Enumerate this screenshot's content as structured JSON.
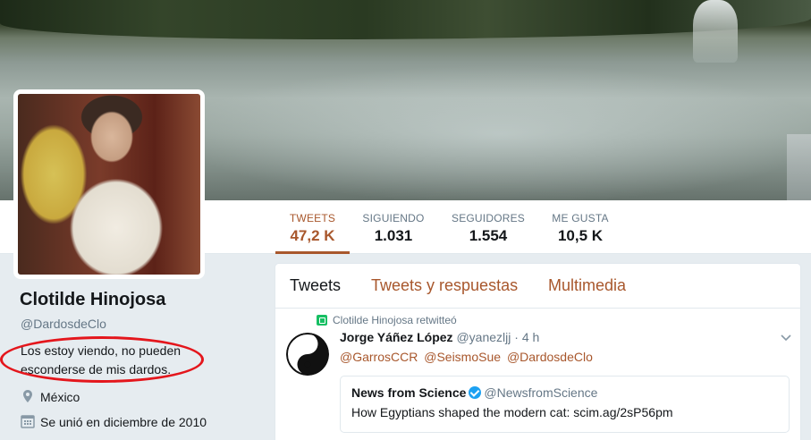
{
  "profile": {
    "name": "Clotilde Hinojosa",
    "handle": "@DardosdeClo",
    "bio": "Los estoy viendo, no pueden esconderse de mis dardos.",
    "location": "México",
    "joined": "Se unió en diciembre de 2010"
  },
  "stats": [
    {
      "label": "TWEETS",
      "value": "47,2 K"
    },
    {
      "label": "SIGUIENDO",
      "value": "1.031"
    },
    {
      "label": "SEGUIDORES",
      "value": "1.554"
    },
    {
      "label": "ME GUSTA",
      "value": "10,5 K"
    }
  ],
  "tabs": [
    "Tweets",
    "Tweets y respuestas",
    "Multimedia"
  ],
  "tweet": {
    "retweet_note": "Clotilde Hinojosa retwitteó",
    "author": "Jorge Yáñez López",
    "handle": "@yanezljj",
    "separator": "·",
    "time": "4 h",
    "mentions": [
      "@GarrosCCR",
      "@SeismoSue",
      "@DardosdeClo"
    ],
    "quote": {
      "author": "News from Science",
      "handle": "@NewsfromScience",
      "text": "How Egyptians shaped the modern cat: scim.ag/2sP56pm"
    }
  },
  "colors": {
    "accent": "#a8572c",
    "annotation": "#e4161c",
    "retweet": "#17bf63",
    "verified": "#1da1f2"
  },
  "icons": {
    "location": "map-pin-icon",
    "joined": "calendar-icon",
    "retweet": "retweet-icon",
    "verified": "verified-badge-icon",
    "menu": "chevron-down-icon"
  }
}
